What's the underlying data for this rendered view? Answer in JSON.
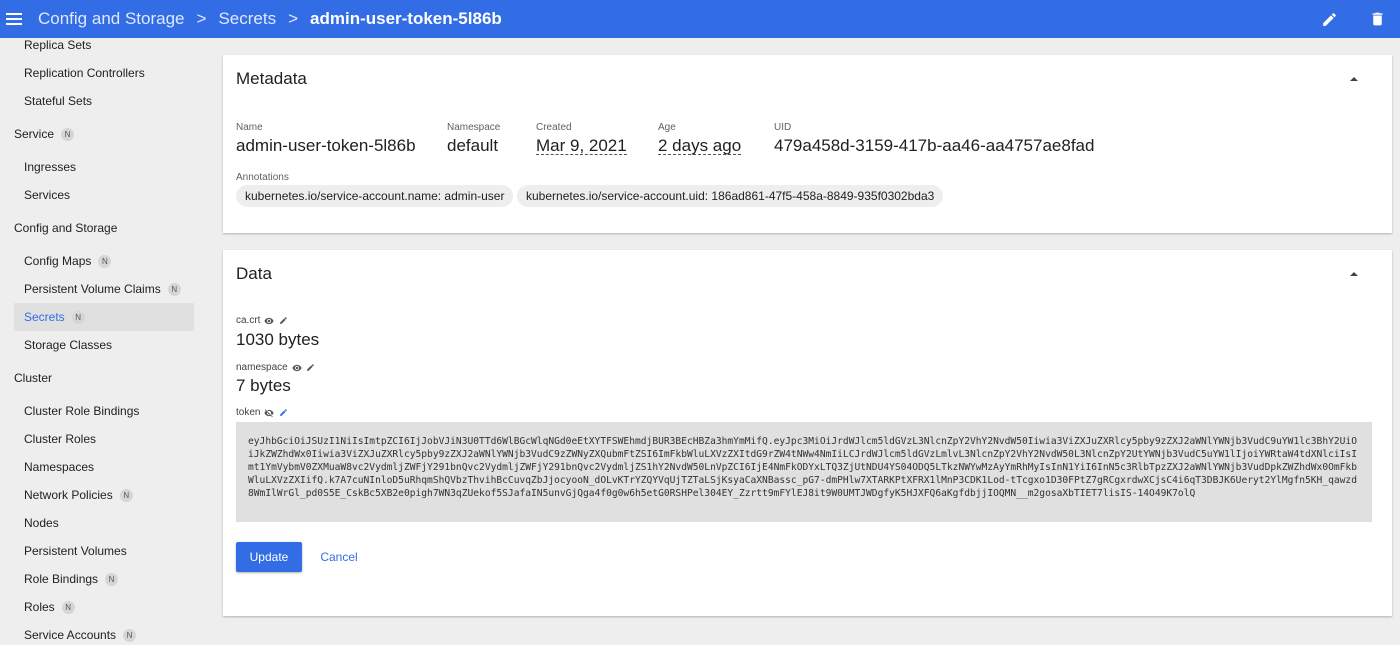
{
  "breadcrumb": {
    "items": [
      "Config and Storage",
      "Secrets"
    ],
    "current": "admin-user-token-5l86b",
    "separator": ">"
  },
  "icons": {
    "menu": "menu-icon",
    "edit": "pencil-icon",
    "delete": "trash-icon",
    "collapse": "chevron-up-icon",
    "reveal": "eye-icon",
    "hide": "eye-off-icon"
  },
  "colors": {
    "accent": "#326de6",
    "background": "#eeeeee",
    "card": "#ffffff"
  },
  "sidebar": {
    "badge": "N",
    "items": {
      "replica_sets": "Replica Sets",
      "replication_controllers": "Replication Controllers",
      "stateful_sets": "Stateful Sets",
      "service_head": "Service",
      "ingresses": "Ingresses",
      "services": "Services",
      "config_head": "Config and Storage",
      "config_maps": "Config Maps",
      "pvc": "Persistent Volume Claims",
      "secrets": "Secrets",
      "storage_classes": "Storage Classes",
      "cluster_head": "Cluster",
      "cluster_role_bindings": "Cluster Role Bindings",
      "cluster_roles": "Cluster Roles",
      "namespaces": "Namespaces",
      "network_policies": "Network Policies",
      "nodes": "Nodes",
      "persistent_volumes": "Persistent Volumes",
      "role_bindings": "Role Bindings",
      "roles": "Roles",
      "service_accounts": "Service Accounts"
    }
  },
  "metadata": {
    "title": "Metadata",
    "name_label": "Name",
    "name": "admin-user-token-5l86b",
    "namespace_label": "Namespace",
    "namespace": "default",
    "created_label": "Created",
    "created": "Mar 9, 2021",
    "age_label": "Age",
    "age": "2 days ago",
    "uid_label": "UID",
    "uid": "479a458d-3159-417b-aa46-aa4757ae8fad",
    "annotations_label": "Annotations",
    "annotations": [
      "kubernetes.io/service-account.name: admin-user",
      "kubernetes.io/service-account.uid: 186ad861-47f5-458a-8849-935f0302bda3"
    ]
  },
  "data": {
    "title": "Data",
    "entries": [
      {
        "key": "ca.crt",
        "value": "1030 bytes"
      },
      {
        "key": "namespace",
        "value": "7 bytes"
      },
      {
        "key": "token"
      }
    ],
    "token_value": "eyJhbGciOiJSUzI1NiIsImtpZCI6IjJobVJiN3U0TTd6WlBGcWlqNGd0eEtXYTFSWEhmdjBUR3BEcHBZa3hmYmMifQ.eyJpc3MiOiJrdWJlcm5ldGVzL3NlcnZpY2VhY2NvdW50Iiwia3ViZXJuZXRlcy5pby9zZXJ2aWNlYWNjb3VudC9uYW1lc3BhY2UiOiJkZWZhdWx0Iiwia3ViZXJuZXRlcy5pby9zZXJ2aWNlYWNjb3VudC9zZWNyZXQubmFtZSI6ImFkbWluLXVzZXItdG9rZW4tNWw4NmIiLCJrdWJlcm5ldGVzLmlvL3NlcnZpY2VhY2NvdW50L3NlcnZpY2UtYWNjb3VudC5uYW1lIjoiYWRtaW4tdXNlciIsImt1YmVybmV0ZXMuaW8vc2VydmljZWFjY291bnQvc2VydmljZWFjY291bnQvc2VydmljZS1hY2NvdW50LnVpZCI6IjE4NmFkODYxLTQ3ZjUtNDU4YS04ODQ5LTkzNWYwMzAyYmRhMyIsInN1YiI6InN5c3RlbTpzZXJ2aWNlYWNjb3VudDpkZWZhdWx0OmFkbWluLXVzZXIifQ.k7A7cuNInloD5uRhqmShQVbzThvihBcCuvqZbJjocyooN_dOLvKTrYZQYVqUjTZTaLSjKsyaCaXNBassc_pG7-dmPHlw7XTARKPtXFRX1lMnP3CDK1Lod-tTcgxo1D30FPtZ7gRCgxrdwXCjsC4i6qT3DBJK6Ueryt2YlMgfn5KH_qawzd8WmIlWrGl_pd0S5E_CskBc5XB2e0pigh7WN3qZUekof5SJafaIN5unvGjQga4f0g0w6h5etG0RSHPel304EY_Zzrtt9mFYlEJ8it9W0UMTJWDgfyK5HJXFQ6aKgfdbjjIOQMN__m2gosaXbTIET7lisIS-14O49K7olQ",
    "update_label": "Update",
    "cancel_label": "Cancel"
  }
}
